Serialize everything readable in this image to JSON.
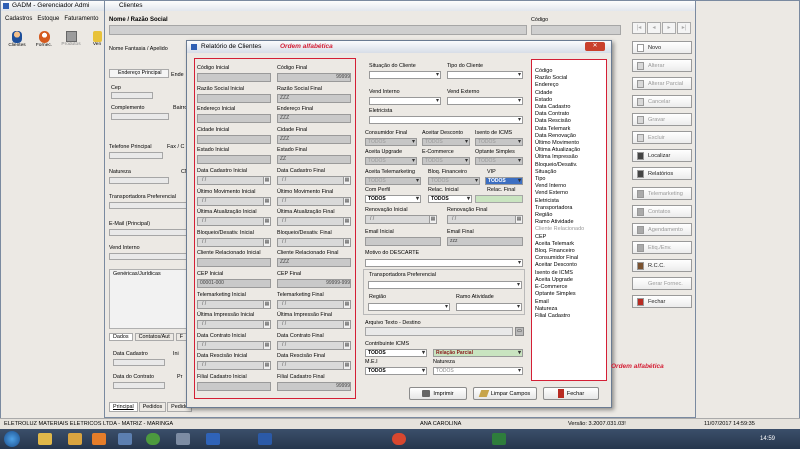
{
  "main_window": {
    "title": "GADM - Gerenciador Admi",
    "menu": [
      "Cadastros",
      "Estoque",
      "Faturamento"
    ],
    "toolbar": [
      "Clientes",
      "Fornec.",
      "Produtos",
      "Ven"
    ]
  },
  "clientes_window": {
    "title": "Clientes",
    "nome_label": "Nome / Razão Social",
    "codigo_label": "Código",
    "fantasia_label": "Nome Fantasia / Apelido",
    "endereco_tab": "Endereço Principal",
    "endereco_tab2": "Ende",
    "cep": "Cep",
    "complemento": "Complemento",
    "bairro": "Bairro",
    "telefone": "Telefone Principal",
    "fax": "Fax / C",
    "natureza": "Natureza",
    "cn": "CN",
    "transportadora": "Transportadora Preferencial",
    "email": "E-Mail (Principal)",
    "vend_interno": "Vend Interno",
    "genericas": "Genéricas/Jurídicas",
    "tabs": [
      "Dados",
      "Contatos/Aut",
      "F"
    ],
    "data_cadastro": "Data Cadastro",
    "data_ini": "Ini",
    "data_contrato": "Data do Contrato",
    "pr": "Pr",
    "bottom_tabs": [
      "Principal",
      "Pedidos",
      "Pedido"
    ]
  },
  "right_buttons": [
    {
      "label": "Novo",
      "icon": "new-doc-icon",
      "enabled": true
    },
    {
      "label": "Alterar",
      "icon": "edit-icon",
      "enabled": false
    },
    {
      "label": "Alterar Parcial",
      "icon": "edit-partial-icon",
      "enabled": false
    },
    {
      "label": "Cancelar",
      "icon": "cancel-icon",
      "enabled": false
    },
    {
      "label": "Gravar",
      "icon": "save-icon",
      "enabled": false
    },
    {
      "label": "Excluir",
      "icon": "delete-icon",
      "enabled": false
    },
    {
      "label": "Localizar",
      "icon": "search-icon",
      "enabled": true
    },
    {
      "label": "Relatórios",
      "icon": "report-icon",
      "enabled": true
    },
    {
      "label": "Telemarketing",
      "icon": "phone-icon",
      "enabled": false
    },
    {
      "label": "Contatos",
      "icon": "contacts-icon",
      "enabled": false
    },
    {
      "label": "Agendamento",
      "icon": "calendar-icon",
      "enabled": false
    },
    {
      "label": "Etiq./Env.",
      "icon": "label-icon",
      "enabled": false
    },
    {
      "label": "R.C.C.",
      "icon": "person-icon",
      "enabled": true
    },
    {
      "label": "Gerar Fornec.",
      "icon": "none",
      "enabled": false
    },
    {
      "label": "Fechar",
      "icon": "exit-icon",
      "enabled": true
    }
  ],
  "dialog": {
    "title": "Relatório de Clientes",
    "annotation_top": "Ordem alfabética",
    "annotation_right": "Ordem alfabética",
    "left_fields": [
      [
        "Código Inicial",
        "",
        "Código Final",
        "99999"
      ],
      [
        "Razão Social Inicial",
        "",
        "Razão Social Final",
        "ZZZ"
      ],
      [
        "Endereço Inicial",
        "",
        "Endereço Final",
        "ZZZ"
      ],
      [
        "Cidade Inicial",
        "",
        "Cidade Final",
        "ZZZ"
      ],
      [
        "Estado Inicial",
        "",
        "Estado Final",
        "ZZ"
      ],
      [
        "Data Cadastro Inicial",
        "/ /",
        "Data Cadastro Final",
        "/ /"
      ],
      [
        "Último Movimento Inicial",
        "/ /",
        "Último Movimento Final",
        "/ /"
      ],
      [
        "Última Atualização Inicial",
        "/ /",
        "Última Atualização Final",
        "/ /"
      ],
      [
        "Bloqueio/Desativ. Inicial",
        "/ /",
        "Bloqueio/Desativ. Final",
        "/ /"
      ],
      [
        "Cliente Relacionado Inicial",
        "",
        "Cliente Relacionado Final",
        "ZZZ"
      ],
      [
        "CEP Inicial",
        "00001-000",
        "CEP Final",
        "99999-999"
      ],
      [
        "Telemarketing Inicial",
        "/ /",
        "Telemarketing Final",
        "/ /"
      ],
      [
        "Última Impressão Inicial",
        "/ /",
        "Última Impressão Final",
        "/ /"
      ],
      [
        "Data Contrato Inicial",
        "/ /",
        "Data Contrato Final",
        "/ /"
      ],
      [
        "Data Rescisão Inicial",
        "/ /",
        "Data Rescisão Final",
        "/ /"
      ],
      [
        "Filial Cadastro Inicial",
        "",
        "Filial Cadastro Final",
        "99999"
      ]
    ],
    "situacao_cliente": "Situação do Cliente",
    "tipo_cliente": "Tipo do Cliente",
    "vend_interno": "Vend Interno",
    "vend_externo": "Vend Externo",
    "eletricista": "Eletricista",
    "consumidor_final": "Consumidor Final",
    "aceitar_desconto": "Aceitar Desconto",
    "isento_icms": "Isento de ICMS",
    "aceita_upgrade": "Aceita Upgrade",
    "e_commerce": "E-Commerce",
    "optante_simples": "Optante Simples",
    "aceita_telemarketing": "Aceita Telemarketing",
    "bloq_financeiro": "Bloq. Financeiro",
    "vip": "VIP",
    "com_perfil": "Com Perfil",
    "relac_inicial": "Relac. Inicial",
    "relac_final": "Relac. Final",
    "renov_inicial": "Renovação Inicial",
    "renov_final": "Renovação Final",
    "email_inicial": "Email Inicial",
    "email_final": "Email Final",
    "email_final_value": "zzz",
    "motivo_descarte": "Motivo do DESCARTE",
    "transportadora": "Transportadora Preferencial",
    "regiao": "Região",
    "ramo_atividade": "Ramo Atividade",
    "arquivo_texto": "Arquivo Texto - Destino",
    "contribuinte_icms": "Contribuinte ICMS",
    "me": "M.E.I",
    "natureza": "Natureza",
    "todos": "TODOS",
    "relacao_parcial": "Relação Parcial",
    "buttons": {
      "imprimir": "Imprimir",
      "limpar": "Limpar Campos",
      "fechar": "Fechar"
    },
    "order_list": [
      "Código",
      "Razão Social",
      "Endereço",
      "Cidade",
      "Estado",
      "Data Cadastro",
      "Data Contrato",
      "Data Rescisão",
      "Data Telemark",
      "Data Renovação",
      "Último Movimento",
      "Última Atualização",
      "Última Impressão",
      "Bloqueio/Desativ.",
      "Situação",
      "Tipo",
      "Vend Interno",
      "Vend Externo",
      "Eletricista",
      "Transportadora",
      "Região",
      "Ramo Atividade",
      "Cliente Relacionado",
      "CEP",
      "Aceita Telemark",
      "Bloq. Financeiro",
      "Consumidor Final",
      "Aceitar Desconto",
      "Isento de ICMS",
      "Aceita Upgrade",
      "E-Commerce",
      "Optante Simples",
      "Email",
      "Natureza",
      "Filial Cadastro"
    ]
  },
  "status_bar": {
    "company": "ELETROLUZ MATERIAIS ELETRICOS LTDA - MATRIZ - MARINGA",
    "user": "ANA CAROLINA",
    "version": "Versão: 3.2007.031.03!",
    "datetime": "11/07/2017 14:59:35"
  },
  "taskbar": {
    "clock": "14:59"
  }
}
